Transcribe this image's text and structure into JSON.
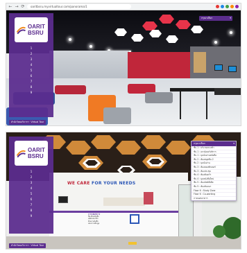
{
  "browser": {
    "url": "oaritbsru.myvirtualtour.com/panorama/1",
    "nav_back": "←",
    "nav_forward": "→",
    "nav_reload": "⟳"
  },
  "brand": {
    "line1": "OARIT",
    "line2": "BSRU",
    "purple": "#5b2d8e",
    "orange": "#f08a1c"
  },
  "sidebar_items": [
    "1",
    "2",
    "3",
    "4",
    "5",
    "6",
    "7",
    "8",
    "9"
  ],
  "bottom_button_label": "สำนักวิทยบริการฯ · Virtual Tour",
  "scene1": {
    "dropdown_label": "กรุณาเลือก"
  },
  "scene2": {
    "slogan_part1": "WE CARE",
    "slogan_part2": " FOR YOUR NEEDS",
    "sign_title": "การให้บริการ",
    "sign_lines": [
      "ยืม-คืนหนังสือ",
      "สมัครสมาชิก",
      "ค้นหาหนังสือ",
      "สอบถามข้อมูล"
    ],
    "dropdown_header": "กรุณาเลือก",
    "dropdown_items": [
      "ชั้น 1 : บริเวณทางเข้า",
      "ชั้น 1 : เคาน์เตอร์บริการ",
      "ชั้น 1 : มุมนั่งอ่านหนังสือ",
      "ชั้น 2 : ห้องสมุดชั้น 2",
      "ชั้น 2 : มุมนั่งอ่าน",
      "ชั้น 3 : ห้องคอมพิวเตอร์",
      "ชั้น 3 : ห้องประชุม",
      "ชั้น 4 : ห้องค้นคว้า",
      "ชั้น 4 : มุมหนังสือใหม่",
      "ชั้น 5 : ห้องมัลติมีเดีย",
      "ชั้น 5 : ห้องสัมมนา",
      "Floor 6 : Study Zone",
      "Floor 6 : Co-working",
      "ภายนอกอาคาร"
    ]
  }
}
